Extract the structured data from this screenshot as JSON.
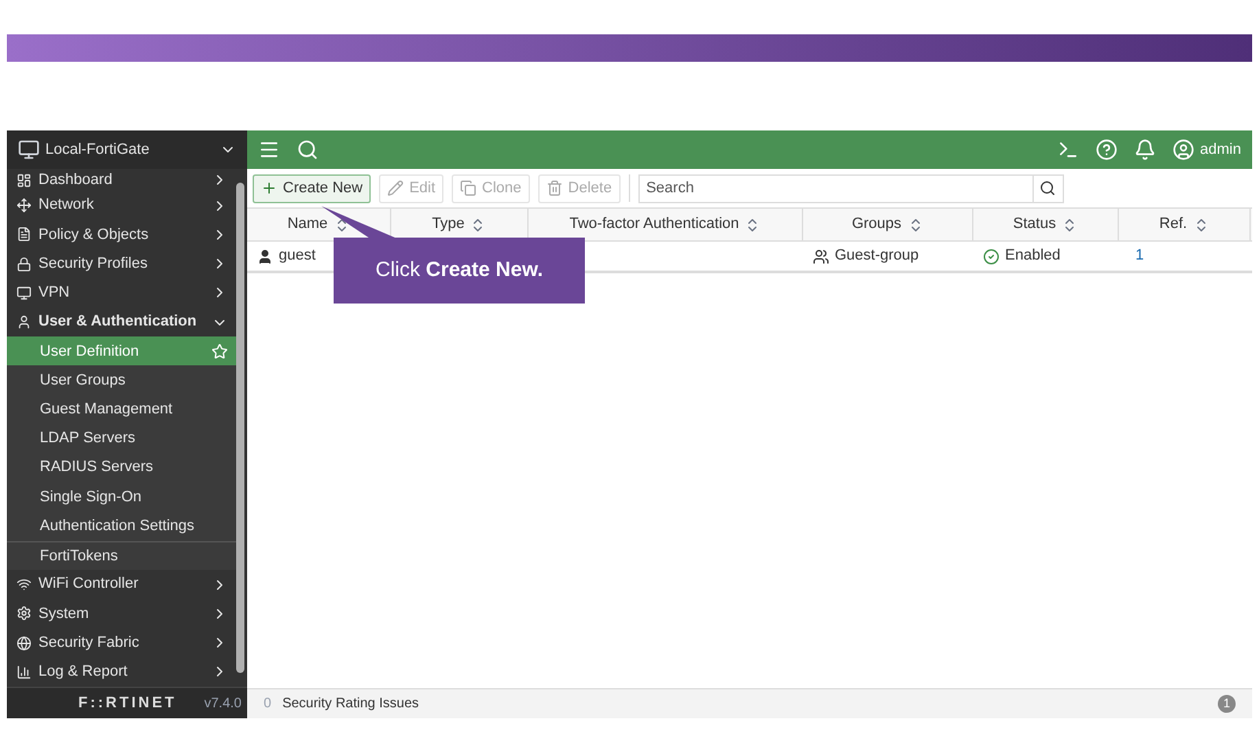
{
  "header": {
    "device_name": "Local-FortiGate",
    "user": "admin"
  },
  "sidebar": {
    "items": [
      {
        "label": "Dashboard",
        "expanded": false
      },
      {
        "label": "Network",
        "expanded": false
      },
      {
        "label": "Policy & Objects",
        "expanded": false
      },
      {
        "label": "Security Profiles",
        "expanded": false
      },
      {
        "label": "VPN",
        "expanded": false
      },
      {
        "label": "User & Authentication",
        "expanded": true,
        "children": [
          {
            "label": "User Definition",
            "selected": true
          },
          {
            "label": "User Groups",
            "selected": false
          },
          {
            "label": "Guest Management",
            "selected": false
          },
          {
            "label": "LDAP Servers",
            "selected": false
          },
          {
            "label": "RADIUS Servers",
            "selected": false
          },
          {
            "label": "Single Sign-On",
            "selected": false
          },
          {
            "label": "Authentication Settings",
            "selected": false
          },
          {
            "label": "FortiTokens",
            "selected": false
          }
        ]
      },
      {
        "label": "WiFi Controller",
        "expanded": false
      },
      {
        "label": "System",
        "expanded": false
      },
      {
        "label": "Security Fabric",
        "expanded": false
      },
      {
        "label": "Log & Report",
        "expanded": false
      }
    ],
    "brand": "F::RTINET",
    "version": "v7.4.0"
  },
  "toolbar": {
    "buttons": [
      {
        "label": "Create New",
        "disabled": false
      },
      {
        "label": "Edit",
        "disabled": true
      },
      {
        "label": "Clone",
        "disabled": true
      },
      {
        "label": "Delete",
        "disabled": true
      }
    ],
    "search": {
      "placeholder": "Search"
    }
  },
  "table": {
    "columns": [
      "Name",
      "Type",
      "Two-factor Authentication",
      "Groups",
      "Status",
      "Ref."
    ],
    "rows": [
      {
        "name": "guest",
        "groups": "Guest-group",
        "status": "Enabled",
        "ref": "1"
      }
    ]
  },
  "callout": {
    "text": "Click **Create New.**"
  },
  "status_bar": {
    "count": "0",
    "text": "Security Rating Issues",
    "badge": "1"
  }
}
